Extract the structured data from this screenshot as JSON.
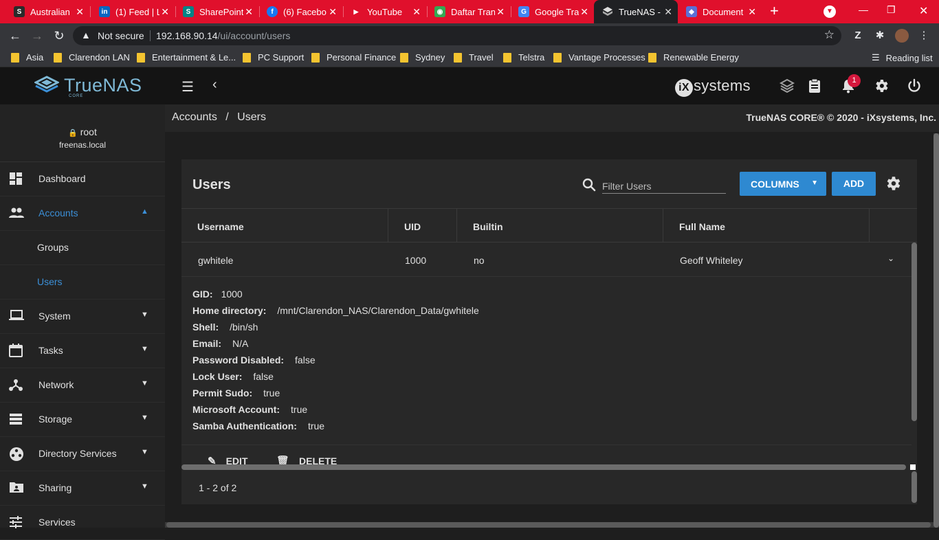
{
  "browser": {
    "tabs": [
      {
        "title": "Australian",
        "favicon": "s-logo-icon",
        "color": "#2b2b2b"
      },
      {
        "title": "(1) Feed | L",
        "favicon": "linkedin-icon",
        "color": "#0a66c2"
      },
      {
        "title": "SharePoint",
        "favicon": "sharepoint-icon",
        "color": "#038387"
      },
      {
        "title": "(6) Facebo",
        "favicon": "facebook-icon",
        "color": "#1877f2"
      },
      {
        "title": "YouTube",
        "favicon": "youtube-icon",
        "color": "#ff0000"
      },
      {
        "title": "Daftar Tran",
        "favicon": "owl-icon",
        "color": "#34a853"
      },
      {
        "title": "Google Tra",
        "favicon": "google-translate-icon",
        "color": "#4285f4"
      },
      {
        "title": "TrueNAS -",
        "favicon": "truenas-icon",
        "color": "#202124"
      },
      {
        "title": "Document",
        "favicon": "document-icon",
        "color": "#5b6fd6"
      }
    ],
    "address": {
      "security_label": "Not secure",
      "host": "192.168.90.14",
      "path": "/ui/account/users"
    },
    "bookmarks": [
      "Asia",
      "Clarendon LAN",
      "Entertainment & Le...",
      "PC Support",
      "Personal Finance",
      "Sydney",
      "Travel",
      "Telstra",
      "Vantage Processes",
      "Renewable Energy"
    ],
    "reading_list_label": "Reading list"
  },
  "app": {
    "logo_text": "TrueNAS",
    "logo_sub": "CORE",
    "vendor_logo": "systems",
    "vendor_logo_mark": "iX",
    "notification_count": "1",
    "accent_color": "#2e89d1"
  },
  "sidebar": {
    "user": "root",
    "host": "freenas.local",
    "items": [
      {
        "label": "Dashboard"
      },
      {
        "label": "Accounts"
      },
      {
        "label": "Groups"
      },
      {
        "label": "Users"
      },
      {
        "label": "System"
      },
      {
        "label": "Tasks"
      },
      {
        "label": "Network"
      },
      {
        "label": "Storage"
      },
      {
        "label": "Directory Services"
      },
      {
        "label": "Sharing"
      },
      {
        "label": "Services"
      }
    ]
  },
  "breadcrumb": {
    "parent": "Accounts",
    "separator": "/",
    "current": "Users"
  },
  "copyright": "TrueNAS CORE® © 2020 - iXsystems, Inc.",
  "users_card": {
    "title": "Users",
    "filter_placeholder": "Filter Users",
    "columns_label": "COLUMNS",
    "add_label": "ADD",
    "headers": [
      "Username",
      "UID",
      "Builtin",
      "Full Name"
    ],
    "rows": [
      {
        "username": "gwhitele",
        "uid": "1000",
        "builtin": "no",
        "full_name": "Geoff Whiteley"
      }
    ],
    "details": [
      {
        "key": "GID:",
        "value": "1000"
      },
      {
        "key": "Home directory:",
        "value": "/mnt/Clarendon_NAS/Clarendon_Data/gwhitele"
      },
      {
        "key": "Shell:",
        "value": "/bin/sh"
      },
      {
        "key": "Email:",
        "value": "N/A"
      },
      {
        "key": "Password Disabled:",
        "value": "false"
      },
      {
        "key": "Lock User:",
        "value": "false"
      },
      {
        "key": "Permit Sudo:",
        "value": "true"
      },
      {
        "key": "Microsoft Account:",
        "value": "true"
      },
      {
        "key": "Samba Authentication:",
        "value": "true"
      }
    ],
    "edit_label": "EDIT",
    "delete_label": "DELETE",
    "pager": "1 - 2 of 2"
  }
}
